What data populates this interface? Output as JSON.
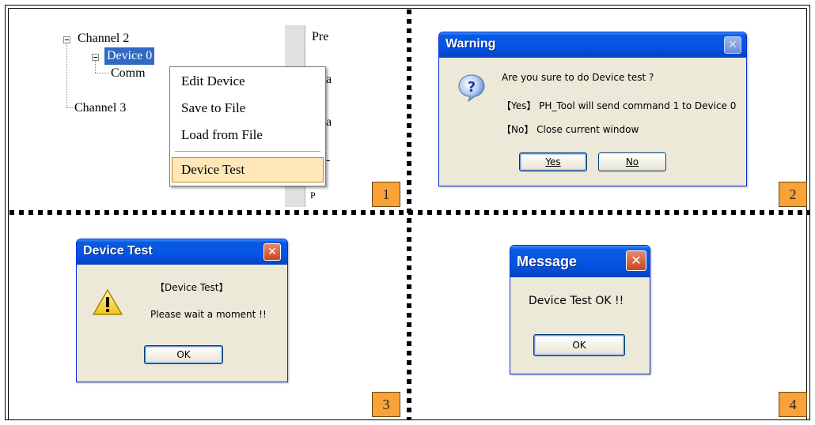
{
  "panels": {
    "p1": {
      "number": "1"
    },
    "p2": {
      "number": "2"
    },
    "p3": {
      "number": "3"
    },
    "p4": {
      "number": "4"
    }
  },
  "tree": {
    "channel2": "Channel 2",
    "device0": "Device 0",
    "comm_partial": "Comm",
    "channel3": "Channel 3"
  },
  "right_pane": {
    "line1": "Pre",
    "frag1": "a",
    "frag2": "a",
    "frag3": "-",
    "frag4": "P"
  },
  "context_menu": {
    "edit_device": "Edit  Device",
    "save_to_file": "Save to File",
    "load_from_file": "Load from File",
    "device_test": "Device Test"
  },
  "warning_dialog": {
    "title": "Warning",
    "question": "Are you sure to do Device test ?",
    "yes_info": "【Yes】 PH_Tool will send command 1 to Device 0",
    "no_info": "【No】 Close current window",
    "yes_button": "Yes",
    "no_button": "No",
    "icon": "question-icon"
  },
  "device_test_dialog": {
    "title": "Device Test",
    "heading": "【Device Test】",
    "message": "Please wait a moment !!",
    "ok_button": "OK",
    "icon": "warning-icon"
  },
  "message_dialog": {
    "title": "Message",
    "message": "Device Test OK !!",
    "ok_button": "OK"
  },
  "colors": {
    "title_bar": "#0454e4",
    "dialog_bg": "#ece9d8",
    "number_badge": "#f8a237",
    "selection": "#316ac5",
    "menu_highlight": "#ffe7b8"
  }
}
